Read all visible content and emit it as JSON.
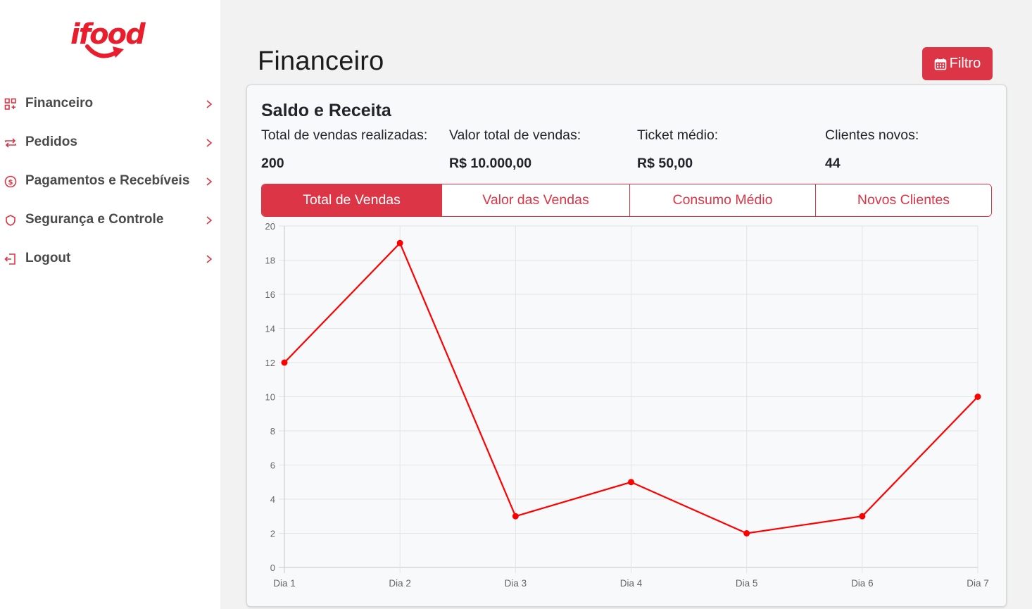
{
  "brand": {
    "logo_text": "ifood",
    "accent_color": "#ea1d2c"
  },
  "sidebar": {
    "items": [
      {
        "label": "Financeiro",
        "icon": "grid-qr-icon"
      },
      {
        "label": "Pedidos",
        "icon": "repeat-arrows-icon"
      },
      {
        "label": "Pagamentos e Recebíveis",
        "icon": "dollar-circle-icon"
      },
      {
        "label": "Segurança e Controle",
        "icon": "shield-icon"
      },
      {
        "label": "Logout",
        "icon": "logout-icon"
      }
    ]
  },
  "header": {
    "title": "Financeiro",
    "filter_label": "Filtro",
    "filter_icon": "calendar-icon"
  },
  "card": {
    "title": "Saldo e Receita",
    "metrics": [
      {
        "label": "Total de vendas realizadas:",
        "value": "200"
      },
      {
        "label": "Valor total de vendas:",
        "value": "R$ 10.000,00"
      },
      {
        "label": "Ticket médio:",
        "value": "R$ 50,00"
      },
      {
        "label": "Clientes novos:",
        "value": "44"
      }
    ],
    "tabs": [
      {
        "label": "Total de Vendas",
        "active": true
      },
      {
        "label": "Valor das Vendas",
        "active": false
      },
      {
        "label": "Consumo Médio",
        "active": false
      },
      {
        "label": "Novos Clientes",
        "active": false
      }
    ]
  },
  "chart_data": {
    "type": "line",
    "categories": [
      "Dia 1",
      "Dia 2",
      "Dia 3",
      "Dia 4",
      "Dia 5",
      "Dia 6",
      "Dia 7"
    ],
    "series": [
      {
        "values": [
          12,
          19,
          3,
          5,
          2,
          3,
          10
        ],
        "color": "#ff0000"
      }
    ],
    "yticks": [
      "0",
      "2",
      "4",
      "6",
      "8",
      "10",
      "12",
      "14",
      "16",
      "18",
      "20"
    ],
    "ylim": [
      0,
      20
    ],
    "grid": true,
    "title": "",
    "xlabel": "",
    "ylabel": ""
  }
}
